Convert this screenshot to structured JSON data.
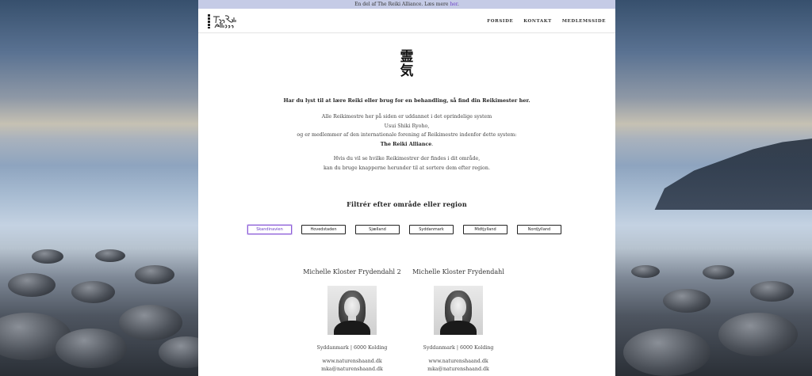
{
  "announcement": {
    "text": "En del af The Reiki Alliance. Læs mere ",
    "link_label": "her",
    "suffix": "."
  },
  "header": {
    "logo_text": "The Reiki Alliance",
    "nav": [
      {
        "label": "FORSIDE"
      },
      {
        "label": "KONTAKT"
      },
      {
        "label": "MEDLEMSSIDE"
      }
    ]
  },
  "hero": {
    "kanji_top": "霊",
    "kanji_bottom": "気",
    "lead": "Har du lyst til at lære Reiki eller brug for en behandling, så find din Reikimester her."
  },
  "intro": {
    "line1": "Alle Reikimestre her på siden er uddannet i det oprindelige system",
    "line2": "Usui Shiki Ryoho,",
    "line3": "og er medlemmer af den internationale forening af Reikimestre indenfor dette system:",
    "line4": "The Reiki Alliance",
    "line4_suffix": "."
  },
  "intro2": {
    "line1": "Hvis du vil se hvilke Reikimestrer der findes i dit område,",
    "line2": "kan du bruge knapperne herunder til at sortere dem efter region."
  },
  "filter": {
    "title": "Filtrér efter område eller region",
    "buttons": [
      {
        "label": "Skandinavien",
        "active": true
      },
      {
        "label": "Hovedstaden",
        "active": false
      },
      {
        "label": "Sjælland",
        "active": false
      },
      {
        "label": "Syddanmark",
        "active": false
      },
      {
        "label": "Midtjylland",
        "active": false
      },
      {
        "label": "Nordjylland",
        "active": false
      }
    ]
  },
  "members": [
    {
      "name": "Michelle Kloster Frydendahl 2",
      "location": "Syddanmark | 6000 Kolding",
      "website": "www.naturenshaand.dk",
      "email": "mka@naturenshaand.dk"
    },
    {
      "name": "Michelle Kloster Frydendahl",
      "location": "Syddanmark | 6000 Kolding",
      "website": "www.naturenshaand.dk",
      "email": "mka@naturenshaand.dk"
    }
  ],
  "colors": {
    "announce_bg": "#c5cbe6",
    "link": "#6b3fc7",
    "active_border": "#8c5cd8"
  }
}
